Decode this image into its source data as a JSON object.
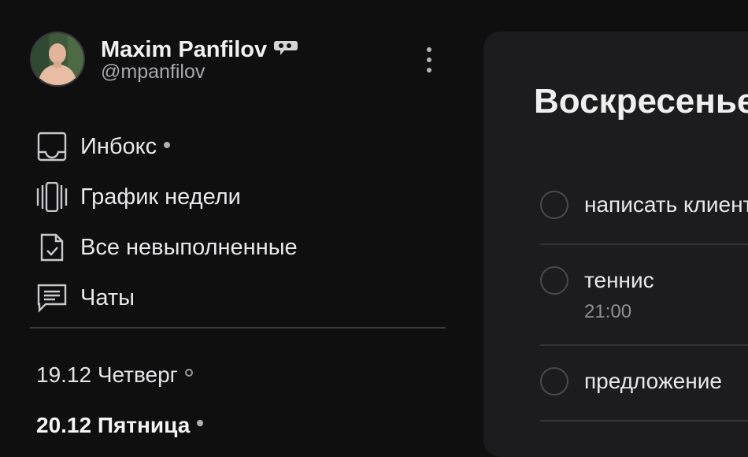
{
  "profile": {
    "name": "Maxim Panfilov",
    "handle": "@mpanfilov"
  },
  "nav": [
    {
      "label": "Инбокс",
      "icon": "inbox-icon",
      "dot": "filled"
    },
    {
      "label": "График недели",
      "icon": "week-schedule-icon"
    },
    {
      "label": "Все невыполненные",
      "icon": "checklist-document-icon"
    },
    {
      "label": "Чаты",
      "icon": "chat-icon"
    }
  ],
  "days": [
    {
      "label": "19.12 Четверг",
      "dot": "hollow",
      "bold": false
    },
    {
      "label": "20.12 Пятница",
      "dot": "filled",
      "bold": true
    }
  ],
  "panel": {
    "title": "Воскресенье",
    "tasks": [
      {
        "text": "написать клиенту",
        "time": ""
      },
      {
        "text": "теннис",
        "time": "21:00"
      },
      {
        "text": "предложение",
        "time": ""
      }
    ]
  },
  "colors": {
    "background": "#0f0f10",
    "panel": "#1c1c1e",
    "text": "#e6e6e6",
    "muted": "#a8a8ad"
  }
}
